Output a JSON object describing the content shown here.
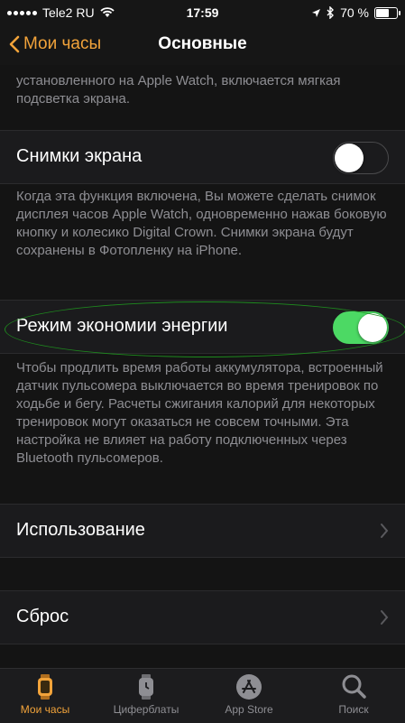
{
  "status_bar": {
    "carrier": "Tele2 RU",
    "time": "17:59",
    "battery": "70 %",
    "battery_level": 0.7
  },
  "nav": {
    "back_label": "Мои часы",
    "title": "Основные"
  },
  "top_note": "установленного на Apple Watch, включается мягкая подсветка экрана.",
  "screenshots": {
    "label": "Снимки экрана",
    "enabled": false,
    "note": "Когда эта функция включена, Вы можете сделать снимок дисплея часов Apple Watch, одновременно нажав боковую кнопку и колесико Digital Crown. Снимки экрана будут сохранены в Фотопленку на iPhone."
  },
  "power_saving": {
    "label": "Режим экономии энергии",
    "enabled": true,
    "note": "Чтобы продлить время работы аккумулятора, встроенный датчик пульсомера выключается во время тренировок по ходьбе и бегу. Расчеты сжигания калорий для некоторых тренировок могут оказаться не совсем точными. Эта настройка не влияет на работу подключенных через Bluetooth пульсомеров."
  },
  "usage": {
    "label": "Использование"
  },
  "reset": {
    "label": "Сброс"
  },
  "tabs": [
    {
      "label": "Мои часы",
      "icon": "watch-icon",
      "active": true
    },
    {
      "label": "Циферблаты",
      "icon": "watch-faces-icon",
      "active": false
    },
    {
      "label": "App Store",
      "icon": "app-store-icon",
      "active": false
    },
    {
      "label": "Поиск",
      "icon": "search-icon",
      "active": false
    }
  ],
  "colors": {
    "accent": "#f2a33a",
    "toggle_on": "#4cd964",
    "annotation": "#1e8a1e"
  }
}
